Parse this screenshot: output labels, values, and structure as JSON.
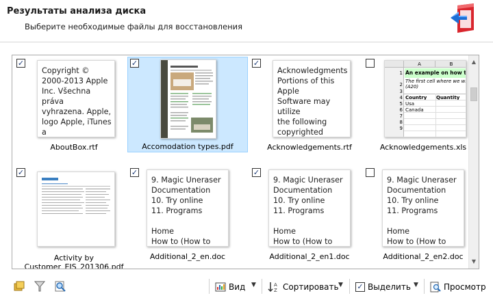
{
  "header": {
    "title": "Результаты анализа диска",
    "subtitle": "Выберите необходимые файлы для восстановления"
  },
  "files": [
    {
      "name": "AboutBox.rtf",
      "checked": true,
      "selected": false,
      "preview": "text",
      "text": "Copyright ©\n2000-2013 Apple\nInc. Všechna práva\nvyhrazena. Apple,\nlogo Apple, iTunes a\nlogo iTunes jsou\nochranné známky\nspolečnosti Apple"
    },
    {
      "name": "Accomodation types.pdf",
      "checked": true,
      "selected": true,
      "preview": "pdf",
      "text": ""
    },
    {
      "name": "Acknowledgements.rtf",
      "checked": true,
      "selected": false,
      "preview": "text",
      "text": "Acknowledgments\nPortions of this Apple\nSoftware may utilize\nthe following\ncopyrighted material,\nthe use of which is\nhereby\nacknowledged."
    },
    {
      "name": "Acknowledgements.xls",
      "checked": false,
      "selected": false,
      "preview": "xls",
      "text": ""
    },
    {
      "name": "Activity by Customer_EIS_201306.pdf",
      "name_line1": "Activity by",
      "name_line2": "Customer_EIS_201306.pdf",
      "checked": true,
      "selected": false,
      "preview": "table",
      "text": ""
    },
    {
      "name": "Additional_2_en.doc",
      "checked": true,
      "selected": false,
      "preview": "text",
      "text": "9. Magic Uneraser\nDocumentation\n10. Try online\n11. Programs\n\nHome\nHow to (How to\nrecover)"
    },
    {
      "name": "Additional_2_en1.doc",
      "checked": true,
      "selected": false,
      "preview": "text",
      "text": "9. Magic Uneraser\nDocumentation\n10. Try online\n11. Programs\n\nHome\nHow to (How to\nrecover)"
    },
    {
      "name": "Additional_2_en2.doc",
      "checked": false,
      "selected": false,
      "preview": "text",
      "text": "9. Magic Uneraser\nDocumentation\n10. Try online\n11. Programs\n\nHome\nHow to (How to\nrecover)"
    }
  ],
  "xls_preview": {
    "col_a": "A",
    "col_b": "B",
    "row1": "An example on how to",
    "row2": "The first cell where we wi",
    "row2b": "(A20)",
    "h_country": "Country",
    "h_quantity": "Quantity",
    "usa": "Usa",
    "canada": "Canada",
    "rows": [
      "1",
      "2",
      "3",
      "4",
      "5",
      "6",
      "7",
      "8",
      "9"
    ]
  },
  "toolbar": {
    "view": "Вид",
    "sort": "Сортировать",
    "select": "Выделить",
    "preview": "Просмотр"
  },
  "colors": {
    "selection_bg": "#cce8ff",
    "selection_border": "#99d1ff",
    "xls_header_green": "#ccffcc"
  }
}
